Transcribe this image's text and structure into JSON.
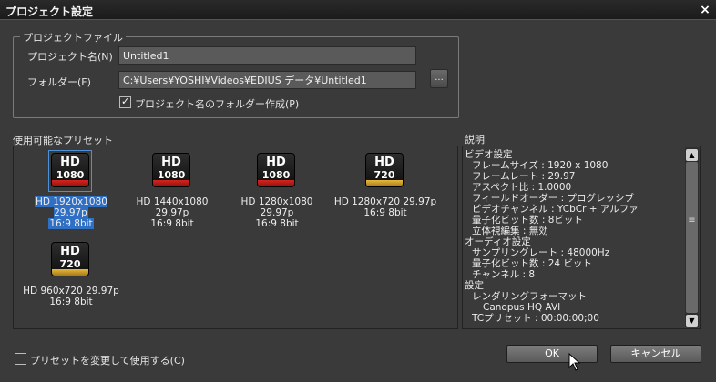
{
  "window": {
    "title": "プロジェクト設定",
    "close_glyph": "×"
  },
  "project_file": {
    "legend": "プロジェクトファイル",
    "name_label": "プロジェクト名(N)",
    "name_value": "Untitled1",
    "folder_label": "フォルダー(F)",
    "folder_value": "C:¥Users¥YOSHI¥Videos¥EDIUS データ¥Untitled1",
    "browse_label": "...",
    "create_folder_label": "プロジェクト名のフォルダー作成(P)",
    "create_folder_checked": true
  },
  "presets": {
    "label": "使用可能なプリセット",
    "items": [
      {
        "badge_top": "HD",
        "badge_res": "1080",
        "stripe": "red",
        "line1": "HD 1920x1080 29.97p",
        "line2": "16:9 8bit",
        "selected": true,
        "icon": "hd-1080-icon"
      },
      {
        "badge_top": "HD",
        "badge_res": "1080",
        "stripe": "red",
        "line1": "HD 1440x1080 29.97p",
        "line2": "16:9 8bit",
        "selected": false,
        "icon": "hd-1080-icon"
      },
      {
        "badge_top": "HD",
        "badge_res": "1080",
        "stripe": "red",
        "line1": "HD 1280x1080 29.97p",
        "line2": "16:9 8bit",
        "selected": false,
        "icon": "hd-1080-icon"
      },
      {
        "badge_top": "HD",
        "badge_res": "720",
        "stripe": "gold",
        "line1": "HD 1280x720 29.97p",
        "line2": "16:9 8bit",
        "selected": false,
        "icon": "hd-720-icon"
      },
      {
        "badge_top": "HD",
        "badge_res": "720",
        "stripe": "gold",
        "line1": "HD 960x720 29.97p",
        "line2": "16:9 8bit",
        "selected": false,
        "icon": "hd-720-icon"
      }
    ]
  },
  "description": {
    "label": "説明",
    "lines": [
      {
        "text": "ビデオ設定",
        "indent": 0
      },
      {
        "text": "フレームサイズ : 1920 x 1080",
        "indent": 1
      },
      {
        "text": "フレームレート : 29.97",
        "indent": 1
      },
      {
        "text": "アスペクト比 : 1.0000",
        "indent": 1
      },
      {
        "text": "フィールドオーダー : プログレッシブ",
        "indent": 1
      },
      {
        "text": "ビデオチャンネル : YCbCr + アルファ",
        "indent": 1
      },
      {
        "text": "量子化ビット数 : 8ビット",
        "indent": 1
      },
      {
        "text": "立体視編集 : 無効",
        "indent": 1
      },
      {
        "text": "オーディオ設定",
        "indent": 0
      },
      {
        "text": "サンプリングレート : 48000Hz",
        "indent": 1
      },
      {
        "text": "量子化ビット数 : 24 ビット",
        "indent": 1
      },
      {
        "text": "チャンネル : 8",
        "indent": 1
      },
      {
        "text": "設定",
        "indent": 0
      },
      {
        "text": "レンダリングフォーマット",
        "indent": 1
      },
      {
        "text": "Canopus HQ AVI",
        "indent": 2
      },
      {
        "text": "TCプリセット : 00:00:00;00",
        "indent": 1
      }
    ]
  },
  "footer": {
    "modify_preset_label": "プリセットを変更して使用する(C)",
    "modify_preset_checked": false,
    "ok_label": "OK",
    "cancel_label": "キャンセル"
  },
  "colors": {
    "background": "#3a3a3a",
    "selection": "#2f6fc4",
    "hd1080_stripe": "#d8231c",
    "hd720_stripe": "#e8b93a"
  }
}
